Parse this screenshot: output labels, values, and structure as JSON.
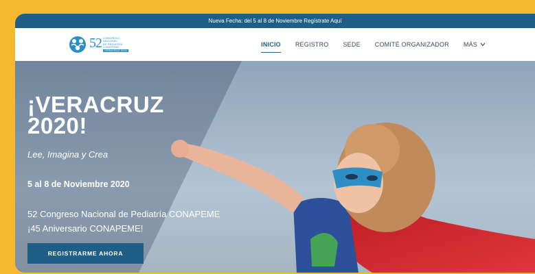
{
  "announcement": "Nueva Fecha: del 5 al 8 de Noviembre Regístrate Aquí",
  "logo": {
    "number": "52",
    "lines": [
      "CONGRESO",
      "NACIONAL",
      "DE PEDIATRÍA",
      "CONAPEME"
    ],
    "bar": "VERACRUZ 2020"
  },
  "nav": {
    "items": [
      {
        "label": "INICIO",
        "active": true
      },
      {
        "label": "REGISTRO"
      },
      {
        "label": "SEDE"
      },
      {
        "label": "COMITÉ ORGANIZADOR"
      },
      {
        "label": "MÁS"
      }
    ]
  },
  "hero": {
    "title_line1": "¡VERACRUZ",
    "title_line2": "2020!",
    "tagline": "Lee, Imagina y Crea",
    "date": "5 al 8 de Noviembre 2020",
    "line1": "52 Congreso Nacional de Pediatría CONAPEME",
    "line2": "¡45 Aniversario CONAPEME!",
    "cta": "REGISTRARME AHORA"
  },
  "colors": {
    "page_bg": "#f5b82e",
    "brand": "#1f5f87",
    "logo_blue": "#2a8ec7",
    "cape_red": "#d4242a",
    "mask_blue": "#2f8fc4"
  },
  "icons": {
    "logo": "children-circle-logo",
    "dropdown": "chevron-down-icon"
  }
}
